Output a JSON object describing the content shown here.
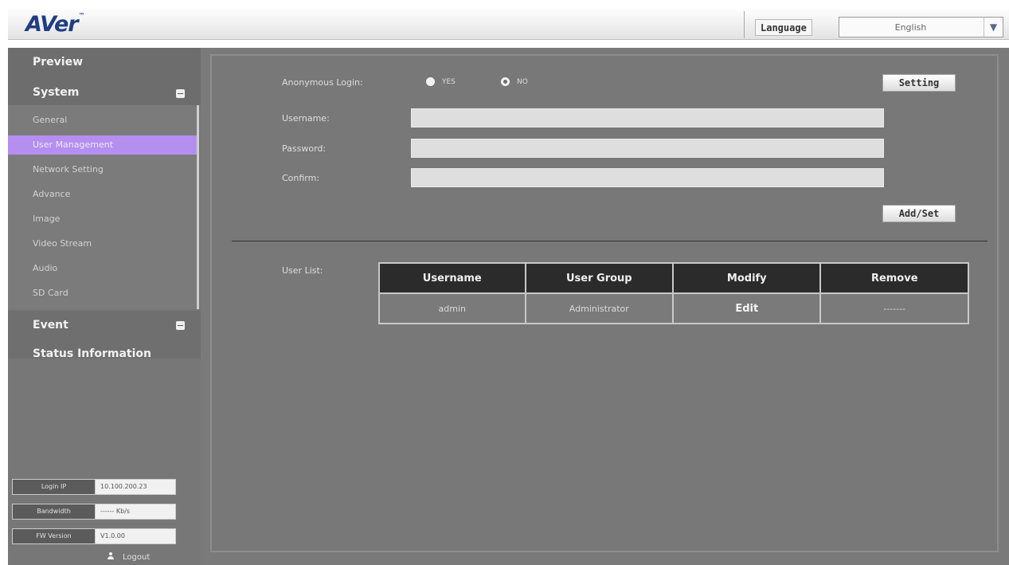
{
  "header": {
    "logo": "AVer",
    "language_label": "Language",
    "language_value": "English"
  },
  "sidebar": {
    "preview": "Preview",
    "system": "System",
    "submenu": [
      {
        "label": "General"
      },
      {
        "label": "User Management",
        "active": true
      },
      {
        "label": "Network Setting"
      },
      {
        "label": "Advance"
      },
      {
        "label": "Image"
      },
      {
        "label": "Video Stream"
      },
      {
        "label": "Audio"
      },
      {
        "label": "SD Card"
      }
    ],
    "event": "Event",
    "status_information": "Status Information",
    "info": [
      {
        "key": "Login IP",
        "value": "10.100.200.23"
      },
      {
        "key": "Bandwidth",
        "value": "------ Kb/s"
      },
      {
        "key": "FW Version",
        "value": "V1.0.00"
      }
    ],
    "logout": "Logout"
  },
  "form": {
    "anonymous_login_label": "Anonymous Login:",
    "yes_label": "YES",
    "no_label": "NO",
    "setting_button": "Setting",
    "username_label": "Username:",
    "password_label": "Password:",
    "confirm_label": "Confirm:",
    "add_set_button": "Add/Set",
    "username_value": "",
    "password_value": "",
    "confirm_value": ""
  },
  "user_list": {
    "label": "User List:",
    "columns": [
      "Username",
      "User Group",
      "Modify",
      "Remove"
    ],
    "rows": [
      [
        "admin",
        "Administrator",
        "Edit",
        "-------"
      ]
    ]
  },
  "colors": {
    "accent_active": "#b48ff0",
    "logo_blue": "#1f3d82",
    "table_header": "#2b2b2b"
  }
}
